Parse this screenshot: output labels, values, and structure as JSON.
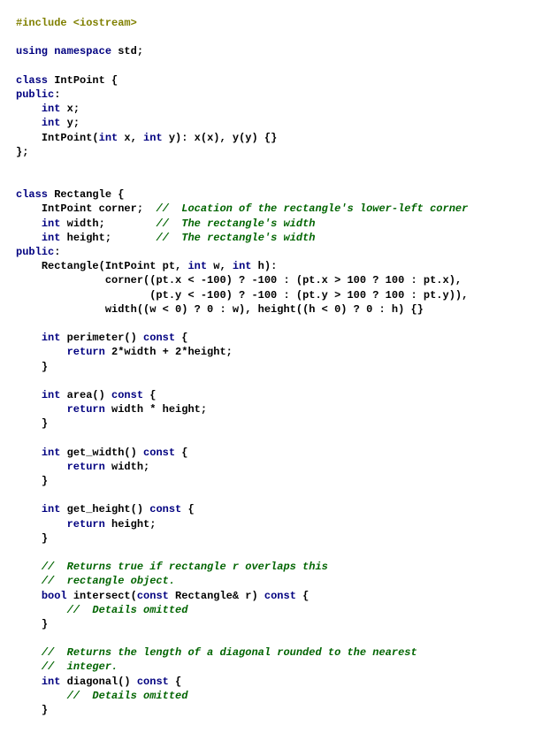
{
  "l1_pp": "#include <iostream>",
  "l3_kw1": "using",
  "l3_kw2": "namespace",
  "l3_id": "std;",
  "l5_kw": "class",
  "l5_id": "IntPoint {",
  "l6_kw": "public",
  "l6_p": ":",
  "l7_kw": "int",
  "l7_id": "x;",
  "l8_kw": "int",
  "l8_id": "y;",
  "l9a": "IntPoint(",
  "l9_kw1": "int",
  "l9b": " x, ",
  "l9_kw2": "int",
  "l9c": " y): x(x), y(y) {}",
  "l10": "};",
  "l13_kw": "class",
  "l13_id": "Rectangle {",
  "l14_id": "IntPoint corner;",
  "l14_cm": "//  Location of the rectangle's lower-left corner",
  "l15_kw": "int",
  "l15_id": "width;",
  "l15_cm": "//  The rectangle's width",
  "l16_kw": "int",
  "l16_id": "height;",
  "l16_cm": "//  The rectangle's width",
  "l17_kw": "public",
  "l17_p": ":",
  "l18a": "Rectangle(IntPoint pt, ",
  "l18_kw1": "int",
  "l18b": " w, ",
  "l18_kw2": "int",
  "l18c": " h):",
  "l19": "corner((pt.x < -100) ? -100 : (pt.x > 100 ? 100 : pt.x),",
  "l20": "(pt.y < -100) ? -100 : (pt.y > 100 ? 100 : pt.y)),",
  "l21": "width((w < 0) ? 0 : w), height((h < 0) ? 0 : h) {}",
  "l23_kw": "int",
  "l23a": " perimeter() ",
  "l23_kw2": "const",
  "l23b": " {",
  "l24_kw": "return",
  "l24_id": " 2*width + 2*height;",
  "l25": "}",
  "l27_kw": "int",
  "l27a": " area() ",
  "l27_kw2": "const",
  "l27b": " {",
  "l28_kw": "return",
  "l28_id": " width * height;",
  "l29": "}",
  "l31_kw": "int",
  "l31a": " get_width() ",
  "l31_kw2": "const",
  "l31b": " {",
  "l32_kw": "return",
  "l32_id": " width;",
  "l33": "}",
  "l35_kw": "int",
  "l35a": " get_height() ",
  "l35_kw2": "const",
  "l35b": " {",
  "l36_kw": "return",
  "l36_id": " height;",
  "l37": "}",
  "l39_cm": "//  Returns true if rectangle r overlaps this",
  "l40_cm": "//  rectangle object.",
  "l41_kw1": "bool",
  "l41a": " intersect(",
  "l41_kw2": "const",
  "l41b": " Rectangle& r) ",
  "l41_kw3": "const",
  "l41c": " {",
  "l42_cm": "//  Details omitted",
  "l43": "}",
  "l45_cm": "//  Returns the length of a diagonal rounded to the nearest",
  "l46_cm": "//  integer.",
  "l47_kw": "int",
  "l47a": " diagonal() ",
  "l47_kw2": "const",
  "l47b": " {",
  "l48_cm": "//  Details omitted",
  "l49": "}"
}
